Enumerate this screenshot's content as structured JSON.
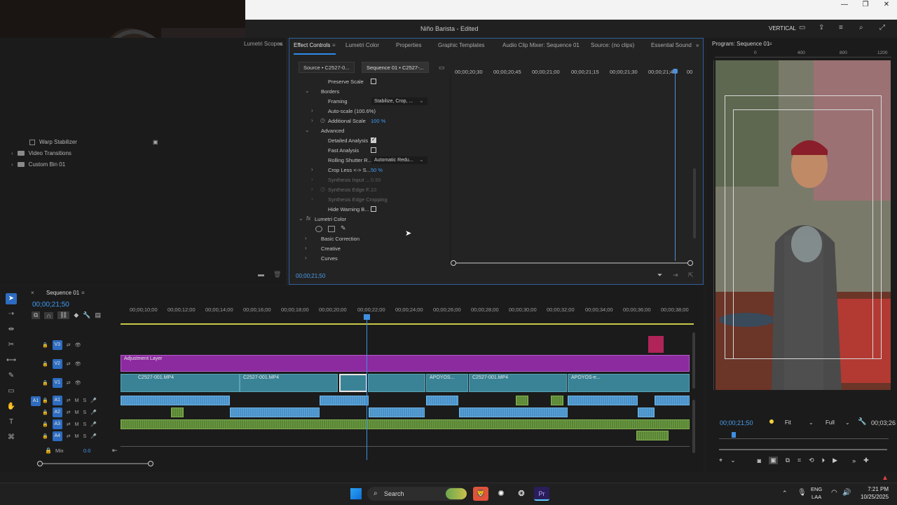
{
  "window": {
    "title": "Niño Barista - Edited",
    "workspace": "VERTICAL",
    "controls": [
      "—",
      "❐",
      "✕"
    ]
  },
  "left_panel": {
    "lumetri_scopes_tab": "Lumetri Scopes",
    "items": [
      {
        "label": "Warp Stabilizer",
        "kind": "effect"
      },
      {
        "label": "Video Transitions",
        "kind": "folder"
      },
      {
        "label": "Custom Bin 01",
        "kind": "folder"
      }
    ]
  },
  "effect_controls": {
    "tabs": [
      "Effect Controls",
      "Lumetri Color",
      "Properties",
      "Graphic Templates",
      "Audio Clip Mixer: Sequence 01",
      "Source: (no clips)",
      "Essential Sound"
    ],
    "subtabs": {
      "source": "Source • C2527-0...",
      "sequence": "Sequence 01 • C2527-..."
    },
    "properties": [
      {
        "label": "Preserve Scale",
        "type": "checkbox",
        "checked": false
      },
      {
        "label": "Borders",
        "type": "group",
        "expanded": true
      },
      {
        "label": "Framing",
        "type": "dropdown",
        "value": "Stabilize, Crop, ..."
      },
      {
        "label": "Auto-scale (100.6%)",
        "type": "group",
        "expanded": false
      },
      {
        "label": "Additional Scale",
        "type": "value",
        "value": "100 %"
      },
      {
        "label": "Advanced",
        "type": "group",
        "expanded": true
      },
      {
        "label": "Detailed Analysis",
        "type": "checkbox",
        "checked": true
      },
      {
        "label": "Fast Analysis",
        "type": "checkbox",
        "checked": false
      },
      {
        "label": "Rolling Shutter R...",
        "type": "dropdown",
        "value": "Automatic Redu..."
      },
      {
        "label": "Crop Less <-> S...",
        "type": "value",
        "value": "50 %"
      },
      {
        "label": "Synthesis Input ...",
        "type": "value",
        "value": "0.50",
        "disabled": true
      },
      {
        "label": "Synthesis Edge F...",
        "type": "value",
        "value": "10",
        "disabled": true
      },
      {
        "label": "Synthesis Edge Cropping",
        "type": "group",
        "disabled": true
      },
      {
        "label": "Hide Warning B...",
        "type": "checkbox",
        "checked": false
      },
      {
        "label": "Lumetri Color",
        "type": "effect",
        "expanded": true
      },
      {
        "label": "Basic Correction",
        "type": "group"
      },
      {
        "label": "Creative",
        "type": "group"
      },
      {
        "label": "Curves",
        "type": "group"
      }
    ],
    "timeline_times": [
      "00;00;20;30",
      "00;00;20;45",
      "00;00;21;00",
      "00;00;21;15",
      "00;00;21;30",
      "00;00;21;45",
      "00"
    ],
    "current_time": "00;00;21;50"
  },
  "program_monitor": {
    "title": "Program: Sequence 01",
    "timecode": "00;00;21;50",
    "duration": "00;03;26",
    "zoom": "Fit",
    "quality": "Full",
    "ruler": [
      "0",
      "400",
      "800",
      "1200"
    ]
  },
  "timeline": {
    "sequence_name": "Sequence 01",
    "timecode": "00;00;21;50",
    "ruler": [
      "00;00;10;00",
      "00;00;12;00",
      "00;00;14;00",
      "00;00;16;00",
      "00;00;18;00",
      "00;00;20;00",
      "00;00;22;00",
      "00;00;24;00",
      "00;00;26;00",
      "00;00;28;00",
      "00;00;30;00",
      "00;00;32;00",
      "00;00;34;00",
      "00;00;36;00",
      "00;00;38;00"
    ],
    "video_tracks": [
      "V3",
      "V2",
      "V1"
    ],
    "audio_tracks": [
      "A1",
      "A2",
      "A3",
      "A4"
    ],
    "source_patch": "A1",
    "adjustment_layer": "Adjustment Layer",
    "clips": [
      "C2527-001.MP4",
      "C2527-001.MP4",
      "APOYOS...",
      "C2527-001.MP4",
      "APOYOS-e..."
    ],
    "mix_label": "Mix",
    "mix_value": "0.0"
  },
  "taskbar": {
    "search": "Search",
    "lang": "ENG",
    "region": "LAA",
    "time": "7:21 PM",
    "date": "10/25/2025"
  }
}
